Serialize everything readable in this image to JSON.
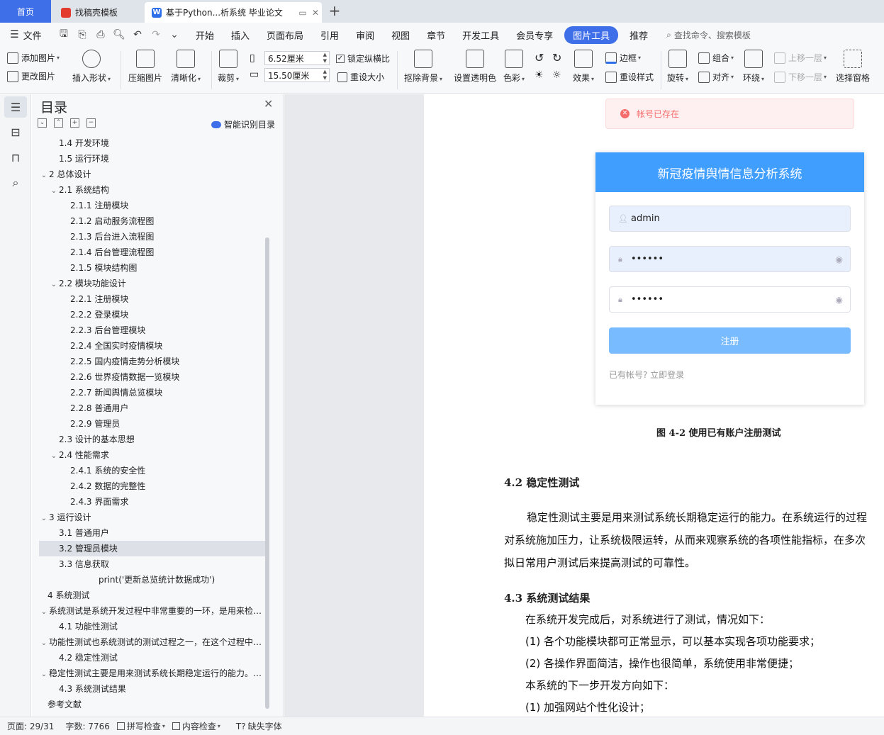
{
  "tabs": {
    "home": "首页",
    "templates": "找稿壳模板",
    "doc": "基于Python...析系统 毕业论文"
  },
  "menu": {
    "file": "文件",
    "items": [
      "开始",
      "插入",
      "页面布局",
      "引用",
      "审阅",
      "视图",
      "章节",
      "开发工具",
      "会员专享",
      "图片工具",
      "推荐"
    ],
    "active": "图片工具",
    "search_placeholder": "查找命令、搜索模板"
  },
  "ribbon": {
    "add_picture": "添加图片",
    "change_picture": "更改图片",
    "insert_shape": "插入形状",
    "compress": "压缩图片",
    "sharpen": "清晰化",
    "crop": "裁剪",
    "width": "6.52厘米",
    "height": "15.50厘米",
    "lock_ratio": "锁定纵横比",
    "reset_size": "重设大小",
    "remove_bg": "抠除背景",
    "set_transparent": "设置透明色",
    "color": "色彩",
    "effects": "效果",
    "border": "边框",
    "reset_style": "重设样式",
    "rotate": "旋转",
    "group": "组合",
    "align": "对齐",
    "wrap": "环绕",
    "move_up": "上移一层",
    "move_down": "下移一层",
    "select_pane": "选择窗格"
  },
  "toc": {
    "title": "目录",
    "smart": "智能识别目录",
    "items": [
      {
        "level": 2,
        "text": "1.4  开发环境"
      },
      {
        "level": 2,
        "text": "1.5  运行环境"
      },
      {
        "level": 1,
        "text": "2  总体设计",
        "toggle": "open"
      },
      {
        "level": 2,
        "text": "2.1 系统结构",
        "toggle": "open"
      },
      {
        "level": 3,
        "text": "2.1.1 注册模块"
      },
      {
        "level": 3,
        "text": "2.1.2 启动服务流程图"
      },
      {
        "level": 3,
        "text": "2.1.3 后台进入流程图"
      },
      {
        "level": 3,
        "text": "2.1.4 后台管理流程图"
      },
      {
        "level": 3,
        "text": "2.1.5 模块结构图"
      },
      {
        "level": 2,
        "text": "2.2 模块功能设计",
        "toggle": "open"
      },
      {
        "level": 3,
        "text": "2.2.1 注册模块"
      },
      {
        "level": 3,
        "text": "2.2.2 登录模块"
      },
      {
        "level": 3,
        "text": "2.2.3 后台管理模块"
      },
      {
        "level": 3,
        "text": "2.2.4 全国实时疫情模块"
      },
      {
        "level": 3,
        "text": "2.2.5 国内疫情走势分析模块"
      },
      {
        "level": 3,
        "text": "2.2.6 世界疫情数据一览模块"
      },
      {
        "level": 3,
        "text": "2.2.7 新闻舆情总览模块"
      },
      {
        "level": 3,
        "text": "2.2.8 普通用户"
      },
      {
        "level": 3,
        "text": "2.2.9 管理员"
      },
      {
        "level": 2,
        "text": "2.3 设计的基本思想"
      },
      {
        "level": 2,
        "text": "2.4 性能需求",
        "toggle": "open"
      },
      {
        "level": 3,
        "text": "2.4.1 系统的安全性"
      },
      {
        "level": 3,
        "text": "2.4.2 数据的完整性"
      },
      {
        "level": 3,
        "text": "2.4.3 界面需求"
      },
      {
        "level": 1,
        "text": "3  运行设计",
        "toggle": "open"
      },
      {
        "level": 2,
        "text": "3.1  普通用户"
      },
      {
        "level": 2,
        "text": "3.2  管理员模块",
        "selected": true
      },
      {
        "level": 2,
        "text": "3.3  信息获取"
      },
      {
        "level": 4,
        "text": "print('更新总览统计数据成功')"
      },
      {
        "level": 1,
        "text": "4  系统测试"
      },
      {
        "level": 0,
        "text": "系统测试是系统开发过程中非常重要的一环，是用来检验系统是否符合要求的",
        "toggle": "open"
      },
      {
        "level": 2,
        "text": "4.1  功能性测试"
      },
      {
        "level": 0,
        "text": "功能性测试也系统测试的测试过程之一，在这个过程中对系统的各项功能进行测试",
        "toggle": "open"
      },
      {
        "level": 2,
        "text": "4.2  稳定性测试"
      },
      {
        "level": 0,
        "text": "稳定性测试主要是用来测试系统长期稳定运行的能力。在系统运行的过程中",
        "toggle": "open"
      },
      {
        "level": 2,
        "text": "4.3  系统测试结果"
      },
      {
        "level": 1,
        "text": "参考文献"
      }
    ]
  },
  "doc": {
    "alert": "帐号已存在",
    "card_title": "新冠疫情舆情信息分析系统",
    "username": "admin",
    "password_mask": "••••••",
    "confirm_mask": "••••••",
    "register_button": "注册",
    "login_link": "已有帐号? 立即登录",
    "figure_caption": "图 4-2 使用已有账户注册测试",
    "h_42": "4.2  稳定性测试",
    "p_42_line1": "稳定性测试主要是用来测试系统长期稳定运行的能力。在系统运行的过程",
    "p_42_line2": "对系统施加压力，让系统极限运转，从而来观察系统的各项性能指标，在多次",
    "p_42_line3": "拟日常用户测试后来提高测试的可靠性。",
    "h_43": "4.3  系统测试结果",
    "p_43_intro": "在系统开发完成后，对系统进行了测试，情况如下：",
    "p_43_item1": "(1) 各个功能模块都可正常显示，可以基本实现各项功能要求；",
    "p_43_item2": "(2) 各操作界面简洁，操作也很简单，系统使用非常便捷；",
    "p_43_next": "本系统的下一步开发方向如下：",
    "p_43_next1": "(1) 加强网站个性化设计；"
  },
  "status": {
    "page": "页面: 29/31",
    "words": "字数: 7766",
    "spell": "拼写检查",
    "content": "内容检查",
    "missing_font": "缺失字体"
  },
  "colors": {
    "accent": "#3f6ee9",
    "card_header": "#409eff",
    "register_button": "#79bbff",
    "alert_text": "#f56c6c"
  }
}
